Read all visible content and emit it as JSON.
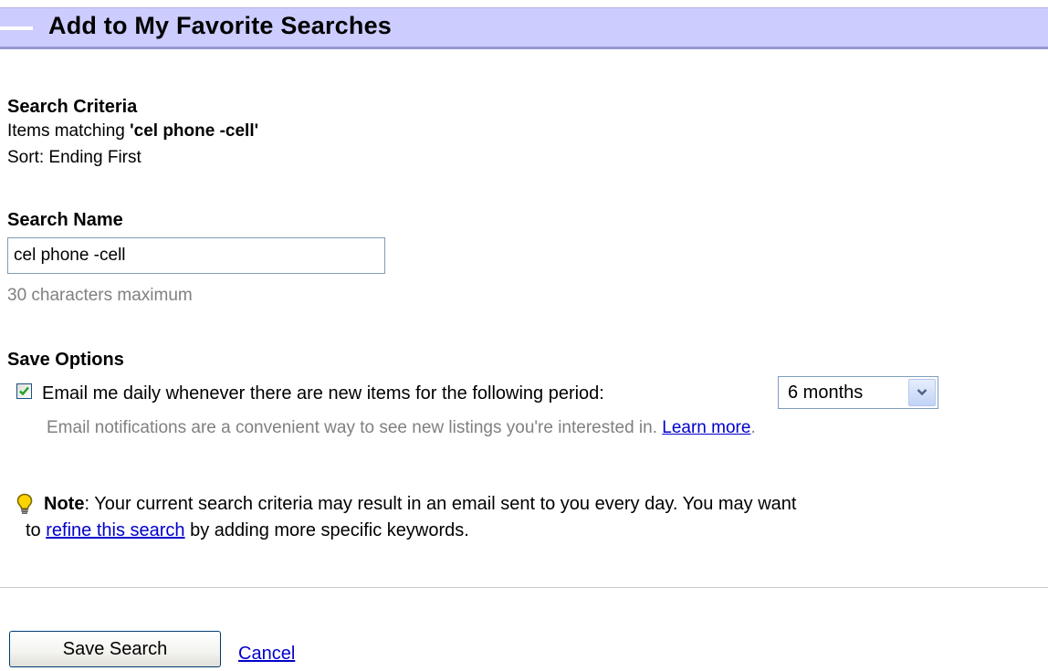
{
  "header": {
    "title": "Add to My Favorite Searches"
  },
  "criteria": {
    "heading": "Search Criteria",
    "items_prefix": "Items matching ",
    "query": "'cel phone -cell'",
    "sort": "Sort: Ending First"
  },
  "search_name": {
    "heading": "Search Name",
    "value": "cel phone -cell",
    "hint": "30 characters maximum"
  },
  "save_options": {
    "heading": "Save Options",
    "email_checked": true,
    "email_label": "Email me daily whenever there are new items for the following period:",
    "period_selected": "6 months",
    "email_hint": "Email notifications are a convenient way to see new listings you're interested in. ",
    "learn_more": "Learn more",
    "email_hint_end": "."
  },
  "note": {
    "label": "Note",
    "text1": ": Your current search criteria may result in an email sent to you every day. You may want",
    "text2_prefix": "to ",
    "refine_link": "refine this search",
    "text2_suffix": " by adding more specific keywords."
  },
  "actions": {
    "save_label": "Save Search",
    "cancel_label": "Cancel"
  },
  "colors": {
    "header_bg": "#ccccff",
    "link": "#0000cc",
    "hint_text": "#808080"
  },
  "icons": {
    "checkbox": "checkmark-icon",
    "select": "chevron-down-icon",
    "note": "lightbulb-icon"
  }
}
